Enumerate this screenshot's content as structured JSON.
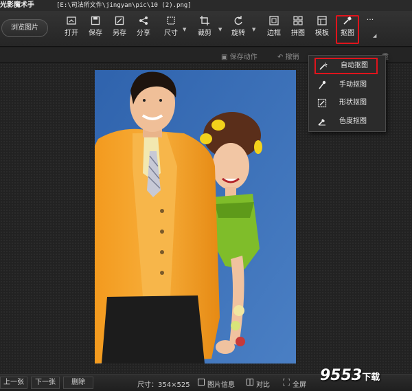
{
  "titlebar": {
    "app_name": "光影魔术手",
    "file_path": "[E:\\司法所文件\\jingyan\\pic\\10 (2).png]"
  },
  "toolbar": {
    "browse_label": "浏览图片",
    "tools": [
      {
        "label": "打开",
        "icon": "open-icon"
      },
      {
        "label": "保存",
        "icon": "save-icon"
      },
      {
        "label": "另存",
        "icon": "save-as-icon"
      },
      {
        "label": "分享",
        "icon": "share-icon"
      },
      {
        "label": "尺寸",
        "icon": "resize-icon"
      },
      {
        "label": "裁剪",
        "icon": "crop-icon"
      },
      {
        "label": "旋转",
        "icon": "rotate-icon"
      },
      {
        "label": "边框",
        "icon": "border-icon"
      },
      {
        "label": "拼图",
        "icon": "collage-icon"
      },
      {
        "label": "模板",
        "icon": "template-icon"
      },
      {
        "label": "抠图",
        "icon": "cutout-icon"
      }
    ],
    "more_label": "···"
  },
  "subbar": {
    "save_action": "保存动作",
    "undo": "撤销",
    "redo_partial": "重"
  },
  "cutout_menu": {
    "items": [
      {
        "label": "自动抠图",
        "icon": "magic-wand-icon"
      },
      {
        "label": "手动抠图",
        "icon": "brush-icon"
      },
      {
        "label": "形状抠图",
        "icon": "shape-icon"
      },
      {
        "label": "色度抠图",
        "icon": "eyedropper-icon"
      }
    ]
  },
  "statusbar": {
    "prev": "上一张",
    "next": "下一张",
    "delete": "删除",
    "size": "尺寸：354×525",
    "info": "图片信息",
    "compare": "对比",
    "fullscreen": "全屏"
  },
  "watermark": {
    "main": "9553",
    "sub": "下载"
  },
  "colors": {
    "highlight_red": "#e0141c",
    "photo_background": "#3b6db4",
    "jacket_orange": "#f5a028"
  }
}
